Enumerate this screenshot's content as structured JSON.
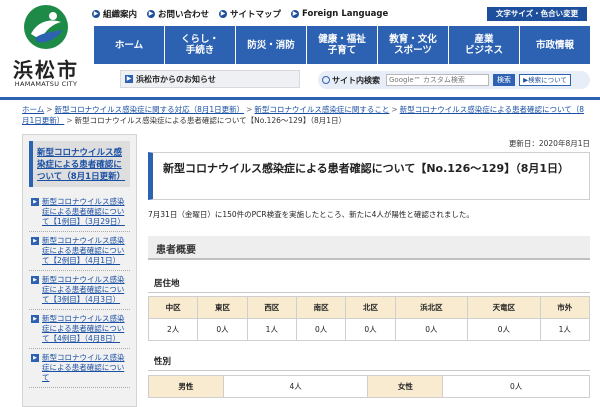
{
  "logo": {
    "name": "浜松市",
    "sub": "HAMAMATSU CITY"
  },
  "utility": [
    {
      "label": "組織案内"
    },
    {
      "label": "お問い合わせ"
    },
    {
      "label": "サイトマップ"
    },
    {
      "label": "Foreign Language"
    }
  ],
  "font_size_btn": "文字サイズ・色合い変更",
  "gnav": [
    "ホーム",
    "くらし・\n手続き",
    "防災・消防",
    "健康・福祉\n子育て",
    "教育・文化\nスポーツ",
    "産業\nビジネス",
    "市政情報"
  ],
  "notice": "浜松市からのお知らせ",
  "search": {
    "label": "サイト内検索",
    "placeholder": "Google™ カスタム検索",
    "button": "検索",
    "about": "検索について"
  },
  "breadcrumb": [
    "ホーム",
    "新型コロナウイルス感染症に関する対応（8月1日更新）",
    "新型コロナウイルス感染症に関すること",
    "新型コロナウイルス感染症による患者確認について（8月1日更新）",
    "新型コロナウイルス感染症による患者確認について【No.126〜129】（8月1日）"
  ],
  "sidebar": {
    "current": "新型コロナウイルス感染症による患者確認について（8月1日更新）",
    "items": [
      "新型コロナウイルス感染症による患者確認について【1例目】（3月29日）",
      "新型コロナウイルス感染症による患者確認について【2例目】（4月1日）",
      "新型コロナウイルス感染症による患者確認について【3例目】（4月3日）",
      "新型コロナウイルス感染症による患者確認について【4例目】（4月8日）",
      "新型コロナウイルス感染症による患者確認について"
    ]
  },
  "main": {
    "updated": "更新日：2020年8月1日",
    "title": "新型コロナウイルス感染症による患者確認について【No.126〜129】（8月1日）",
    "intro": "7月31日（金曜日）に150件のPCR検査を実施したところ、新たに4人が陽性と確認されました。",
    "outline_heading": "患者概要",
    "residence_heading": "居住地",
    "residence_headers": [
      "中区",
      "東区",
      "西区",
      "南区",
      "北区",
      "浜北区",
      "天竜区",
      "市外"
    ],
    "residence_values": [
      "2人",
      "0人",
      "1人",
      "0人",
      "0人",
      "0人",
      "0人",
      "1人"
    ],
    "sex_heading": "性別",
    "sex_row": {
      "male_label": "男性",
      "male_value": "4人",
      "female_label": "女性",
      "female_value": "0人"
    }
  },
  "colors": {
    "brand_blue": "#2d62b3",
    "table_header": "#f8ebd0"
  }
}
